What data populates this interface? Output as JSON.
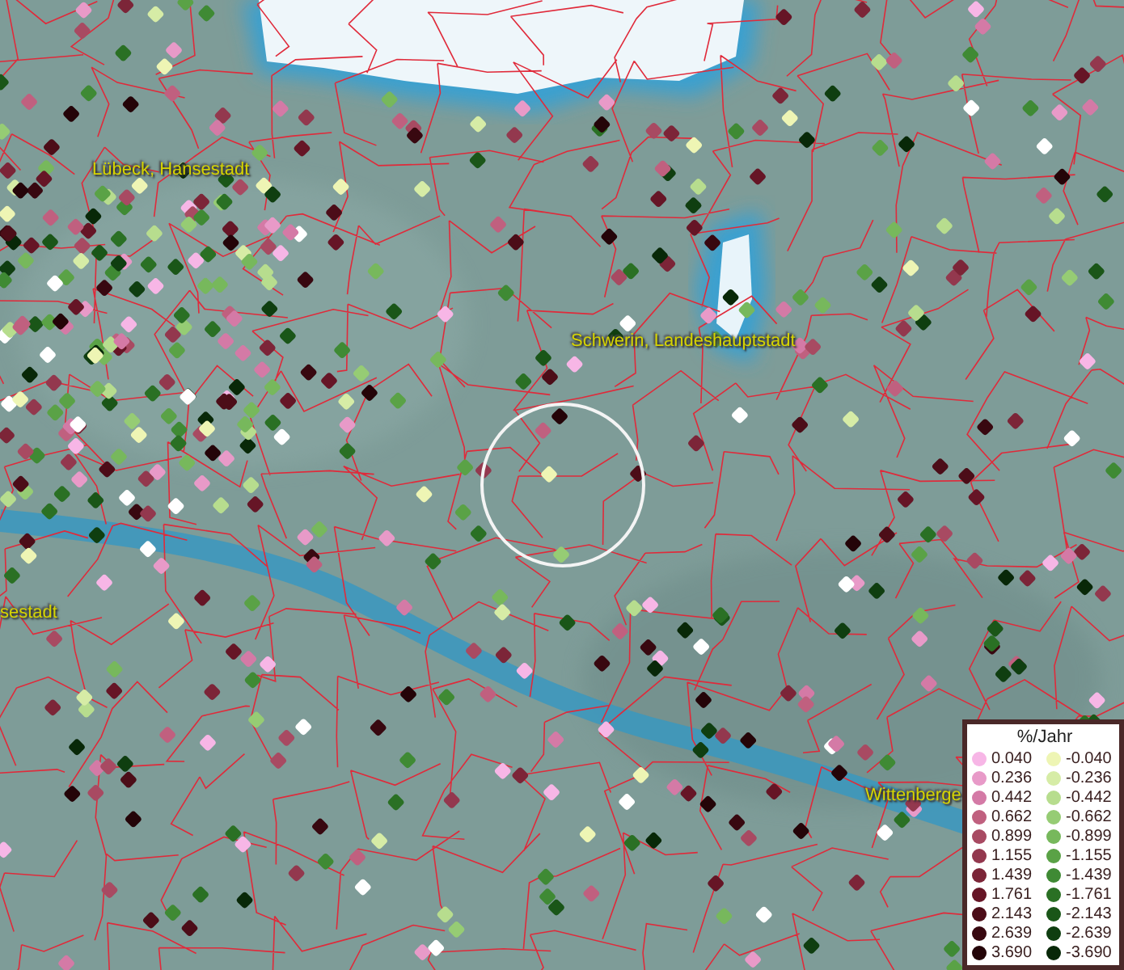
{
  "map": {
    "labels": [
      {
        "text": "Lübeck, Hansestadt"
      },
      {
        "text": "Schwerin, Landeshauptstadt"
      },
      {
        "text": "sestadt"
      },
      {
        "text": "Wittenberge"
      }
    ]
  },
  "legend": {
    "title": "%/Jahr",
    "positive": [
      {
        "label": "0.040",
        "color": "#f7b6e6"
      },
      {
        "label": "0.236",
        "color": "#e89ac8"
      },
      {
        "label": "0.442",
        "color": "#d47aa6"
      },
      {
        "label": "0.662",
        "color": "#c0607f"
      },
      {
        "label": "0.899",
        "color": "#a84a62"
      },
      {
        "label": "1.155",
        "color": "#93384e"
      },
      {
        "label": "1.439",
        "color": "#7c2538"
      },
      {
        "label": "1.761",
        "color": "#661526"
      },
      {
        "label": "2.143",
        "color": "#4c0d18"
      },
      {
        "label": "2.639",
        "color": "#380810"
      },
      {
        "label": "3.690",
        "color": "#240408"
      }
    ],
    "negative": [
      {
        "label": "-0.040",
        "color": "#eef5b4"
      },
      {
        "label": "-0.236",
        "color": "#d6eca6"
      },
      {
        "label": "-0.442",
        "color": "#b7dd8e"
      },
      {
        "label": "-0.662",
        "color": "#96cc74"
      },
      {
        "label": "-0.899",
        "color": "#77b85c"
      },
      {
        "label": "-1.155",
        "color": "#5aa246"
      },
      {
        "label": "-1.439",
        "color": "#3f8a34"
      },
      {
        "label": "-1.761",
        "color": "#2a7024"
      },
      {
        "label": "-2.143",
        "color": "#1a5618"
      },
      {
        "label": "-2.639",
        "color": "#0f3e10"
      },
      {
        "label": "-3.690",
        "color": "#082808"
      }
    ]
  }
}
